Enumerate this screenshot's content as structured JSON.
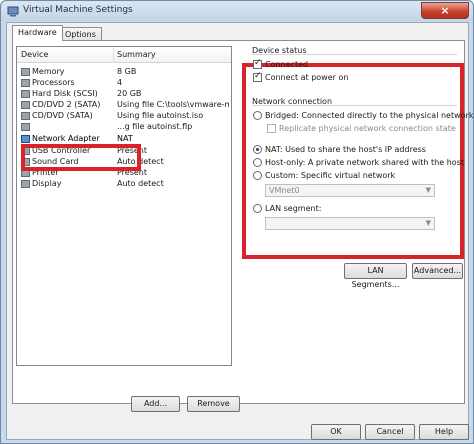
{
  "window": {
    "title": "Virtual Machine Settings",
    "close_label": "×"
  },
  "tabs": [
    {
      "label": "Hardware"
    },
    {
      "label": "Options"
    }
  ],
  "device_list": {
    "columns": {
      "device": "Device",
      "summary": "Summary"
    },
    "rows": [
      {
        "name": "Memory",
        "summary": "8 GB",
        "icon": "memory-icon"
      },
      {
        "name": "Processors",
        "summary": "4",
        "icon": "processor-icon"
      },
      {
        "name": "Hard Disk (SCSI)",
        "summary": "20 GB",
        "icon": "hard-disk-icon"
      },
      {
        "name": "CD/DVD 2 (SATA)",
        "summary": "Using file C:\\tools\\vmware-mac...",
        "icon": "cd-dvd-icon"
      },
      {
        "name": "CD/DVD (SATA)",
        "summary": "Using file autoinst.iso",
        "icon": "cd-dvd-icon"
      },
      {
        "name": "",
        "summary": "...g file autoinst.flp",
        "icon": "floppy-icon"
      },
      {
        "name": "Network Adapter",
        "summary": "NAT",
        "icon": "network-adapter-icon"
      },
      {
        "name": "USB Controller",
        "summary": "Present",
        "icon": "usb-icon"
      },
      {
        "name": "Sound Card",
        "summary": "Auto detect",
        "icon": "sound-card-icon"
      },
      {
        "name": "Printer",
        "summary": "Present",
        "icon": "printer-icon"
      },
      {
        "name": "Display",
        "summary": "Auto detect",
        "icon": "display-icon"
      }
    ],
    "add_label": "Add...",
    "remove_label": "Remove"
  },
  "device_status": {
    "title": "Device status",
    "connected_label": "Connected",
    "connected_checked": true,
    "connect_power_label": "Connect at power on",
    "connect_power_checked": true
  },
  "network_connection": {
    "title": "Network connection",
    "bridged_label": "Bridged: Connected directly to the physical network",
    "replicate_label": "Replicate physical network connection state",
    "nat_label": "NAT: Used to share the host's IP address",
    "hostonly_label": "Host-only: A private network shared with the host",
    "custom_label": "Custom: Specific virtual network",
    "custom_value": "VMnet0",
    "lan_label": "LAN segment:",
    "selected": "nat"
  },
  "buttons": {
    "lan_segments": "LAN Segments...",
    "advanced": "Advanced...",
    "ok": "OK",
    "cancel": "Cancel",
    "help": "Help"
  }
}
